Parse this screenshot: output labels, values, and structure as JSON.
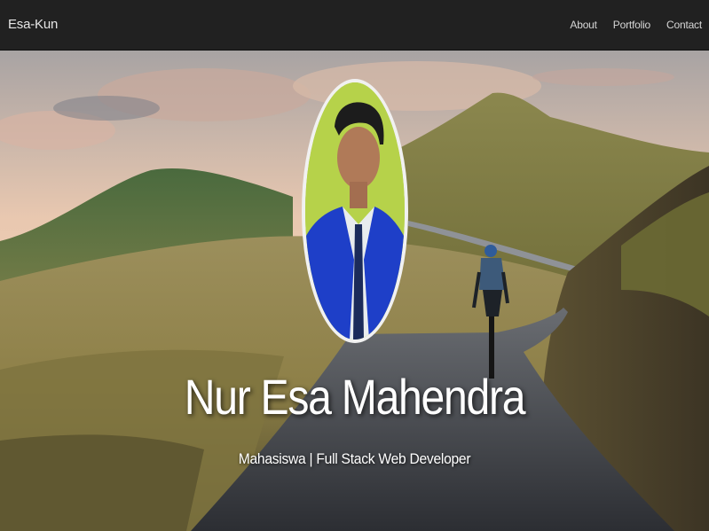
{
  "navbar": {
    "brand": "Esa-Kun",
    "links": [
      "About",
      "Portfolio",
      "Contact"
    ]
  },
  "hero": {
    "name": "Nur Esa Mahendra",
    "tagline": "Mahasiswa | Full Stack Web Developer",
    "colors": {
      "navbar_bg": "#212121",
      "sky": "#e9c8b0",
      "hills": "#8a8a4a",
      "road": "#3a3d42",
      "avatar_bg": "#b6d24a",
      "jacket": "#1e3fc8"
    }
  }
}
